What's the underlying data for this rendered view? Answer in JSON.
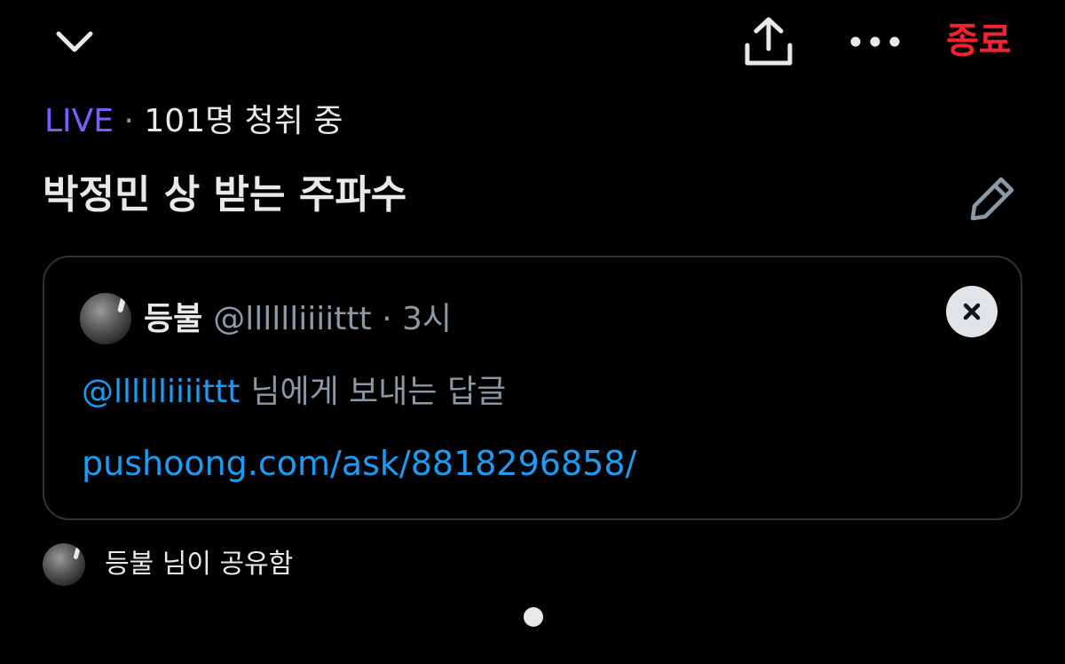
{
  "header": {
    "collapse_icon": "chevron-down-icon",
    "share_icon": "share-upload-icon",
    "more_icon": "more-horizontal-icon",
    "end_label": "종료"
  },
  "space": {
    "live_label": "LIVE",
    "separator": "·",
    "listeners_text": "101명 청취 중",
    "title": "박정민 상 받는 주파수",
    "edit_icon": "pencil-icon"
  },
  "pinned_post": {
    "author_name": "등불",
    "author_handle": "@lllllliiiittt",
    "separator": "·",
    "time": "3시",
    "dismiss_icon": "close-icon",
    "reply_mention": "@lllllliiiittt",
    "reply_text": "님에게 보내는 답글",
    "link": "pushoong.com/ask/8818296858/"
  },
  "shared_by": {
    "text": "등불 님이 공유함"
  },
  "colors": {
    "background": "#000000",
    "live_accent": "#7c5cff",
    "link_blue": "#1d9bf0",
    "end_red": "#f4212e",
    "muted_text": "#8b98a5",
    "card_border": "#2f3336"
  }
}
